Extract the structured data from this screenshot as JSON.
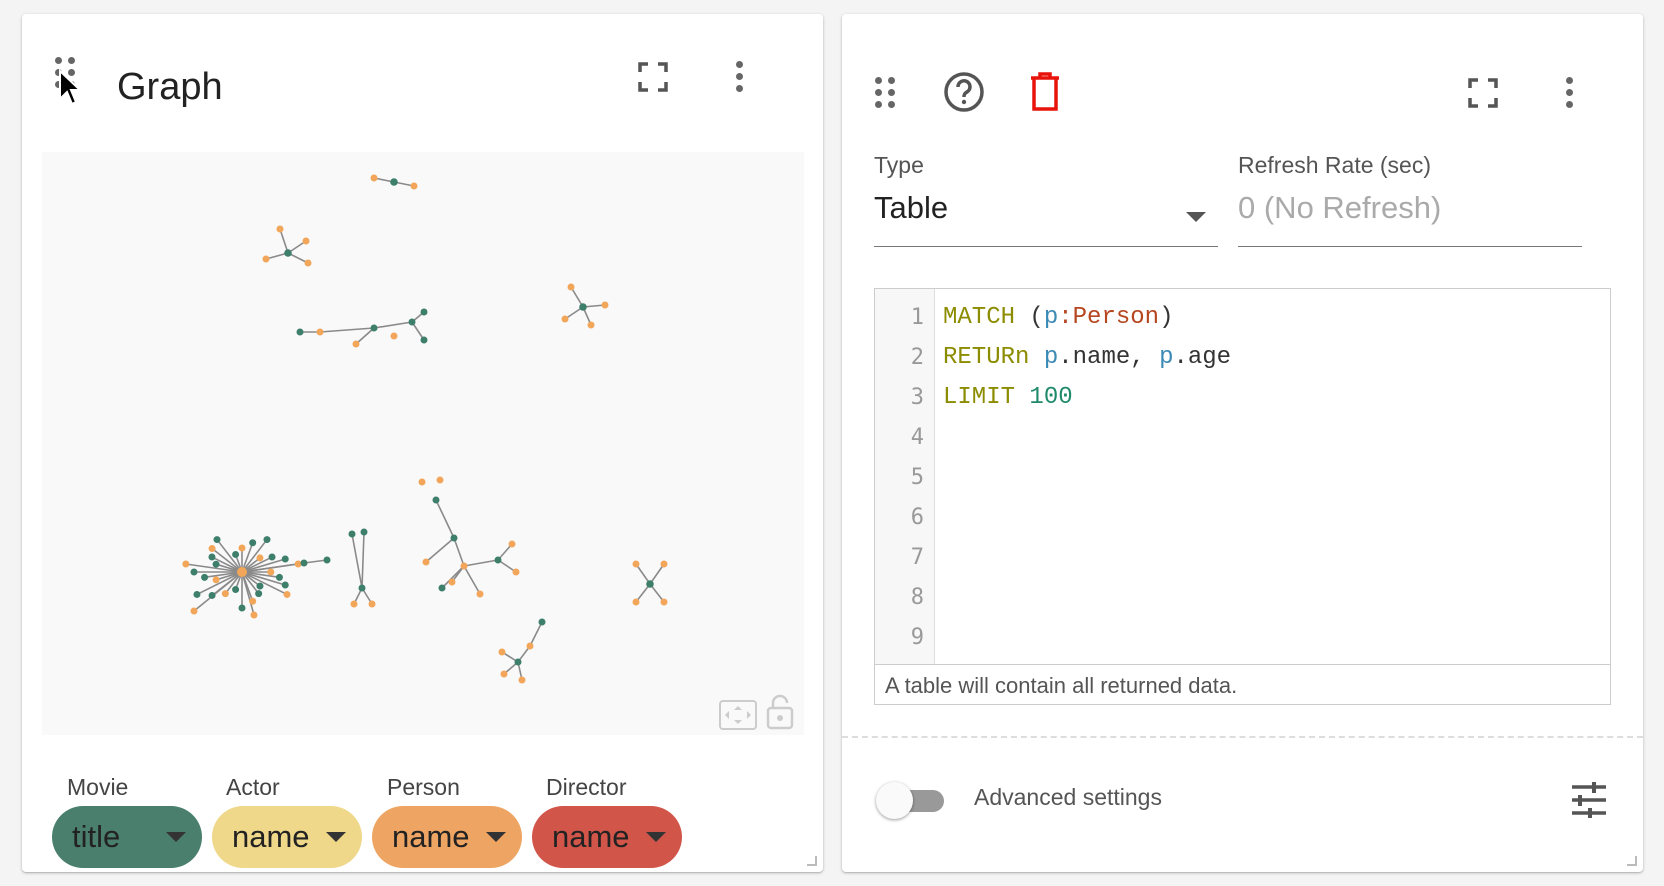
{
  "graph_card": {
    "title": "Graph",
    "legend": [
      {
        "label": "Movie",
        "property": "title",
        "color": "#4b7f6d"
      },
      {
        "label": "Actor",
        "property": "name",
        "color": "#efd88a"
      },
      {
        "label": "Person",
        "property": "name",
        "color": "#eea563"
      },
      {
        "label": "Director",
        "property": "name",
        "color": "#d2554a"
      }
    ],
    "node_colors": {
      "movie": "#3d7f6b",
      "person": "#f2a65a",
      "edge": "#8a8a8a"
    }
  },
  "editor_card": {
    "type_label": "Type",
    "type_value": "Table",
    "refresh_label": "Refresh Rate (sec)",
    "refresh_placeholder": "0 (No Refresh)",
    "line_numbers": [
      "1",
      "2",
      "3",
      "4",
      "5",
      "6",
      "7",
      "8",
      "9"
    ],
    "query_lines": [
      [
        {
          "t": "MATCH",
          "c": "kw"
        },
        {
          "t": " (",
          "c": ""
        },
        {
          "t": "p",
          "c": "var"
        },
        {
          "t": ":Person",
          "c": "lbl"
        },
        {
          "t": ")",
          "c": ""
        }
      ],
      [
        {
          "t": "RETURn",
          "c": "kw"
        },
        {
          "t": " ",
          "c": ""
        },
        {
          "t": "p",
          "c": "var"
        },
        {
          "t": ".name, ",
          "c": ""
        },
        {
          "t": "p",
          "c": "var"
        },
        {
          "t": ".age",
          "c": ""
        }
      ],
      [
        {
          "t": "LIMIT",
          "c": "kw"
        },
        {
          "t": " ",
          "c": ""
        },
        {
          "t": "100",
          "c": "num"
        }
      ]
    ],
    "help_text": "A table will contain all returned data.",
    "advanced_label": "Advanced settings",
    "delete_color": "#e8140c"
  }
}
